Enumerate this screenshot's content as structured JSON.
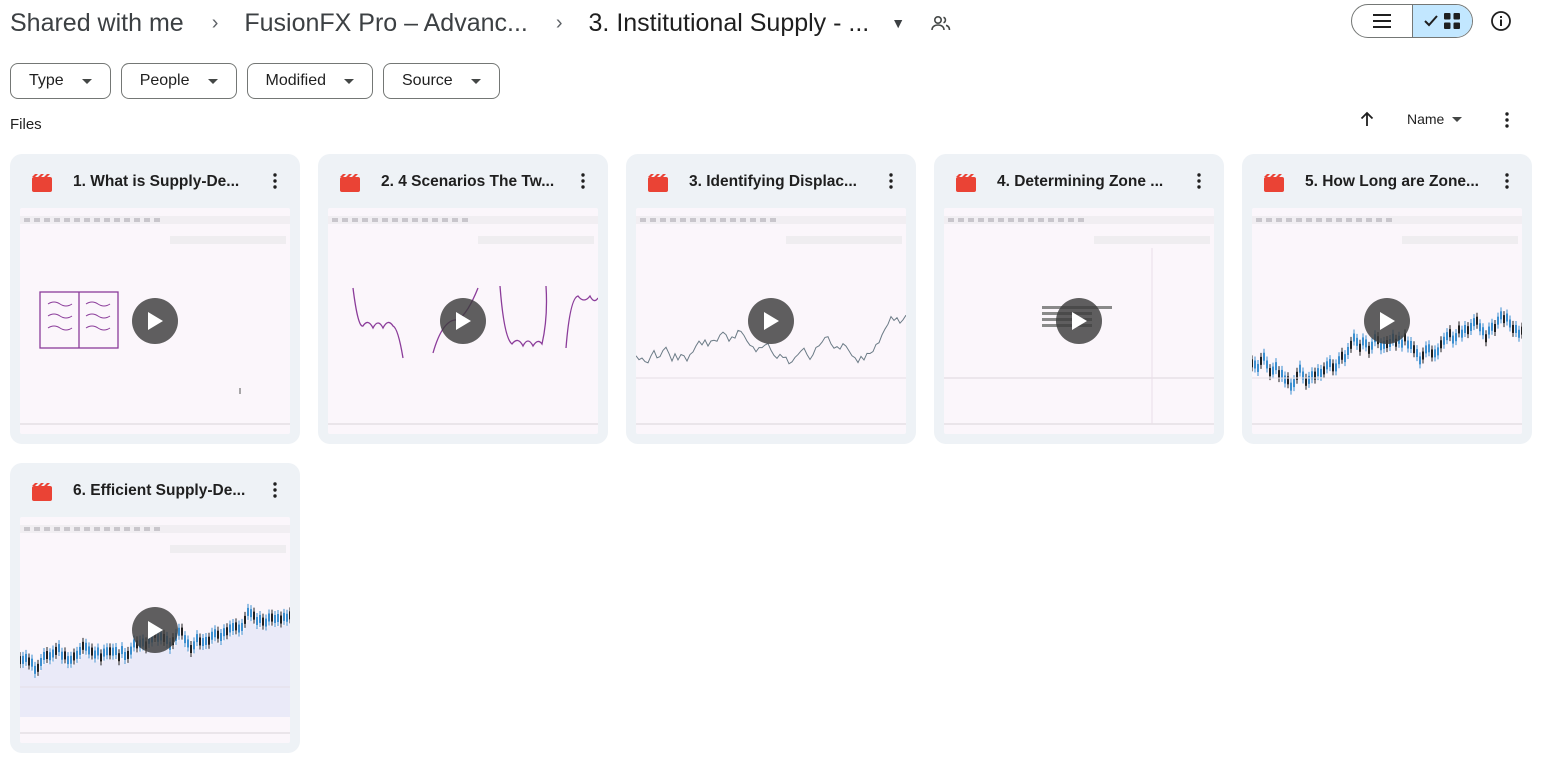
{
  "breadcrumb": {
    "items": [
      "Shared with me",
      "FusionFX Pro – Advanc...",
      "3. Institutional Supply - ..."
    ]
  },
  "filters": [
    "Type",
    "People",
    "Modified",
    "Source"
  ],
  "section": {
    "label": "Files"
  },
  "sort": {
    "field": "Name"
  },
  "files": [
    {
      "title": "1. What is Supply-De...",
      "thumb": "drawing-book"
    },
    {
      "title": "2. 4 Scenarios The Tw...",
      "thumb": "drawing-waves"
    },
    {
      "title": "3. Identifying Displac...",
      "thumb": "chart-line"
    },
    {
      "title": "4. Determining Zone ...",
      "thumb": "text-slide"
    },
    {
      "title": "5. How Long are Zone...",
      "thumb": "chart-candles"
    },
    {
      "title": "6. Efficient Supply-De...",
      "thumb": "chart-candles-band"
    }
  ],
  "colors": {
    "accent": "#c2e7ff",
    "video_icon": "#ea4335",
    "card_bg": "#eef2f6"
  },
  "icons": [
    "chevron-right-icon",
    "caret-down-icon",
    "shared-people-icon",
    "list-view-icon",
    "check-icon",
    "grid-view-icon",
    "info-icon",
    "arrow-up-icon",
    "more-vert-icon",
    "video-file-icon",
    "play-icon"
  ]
}
